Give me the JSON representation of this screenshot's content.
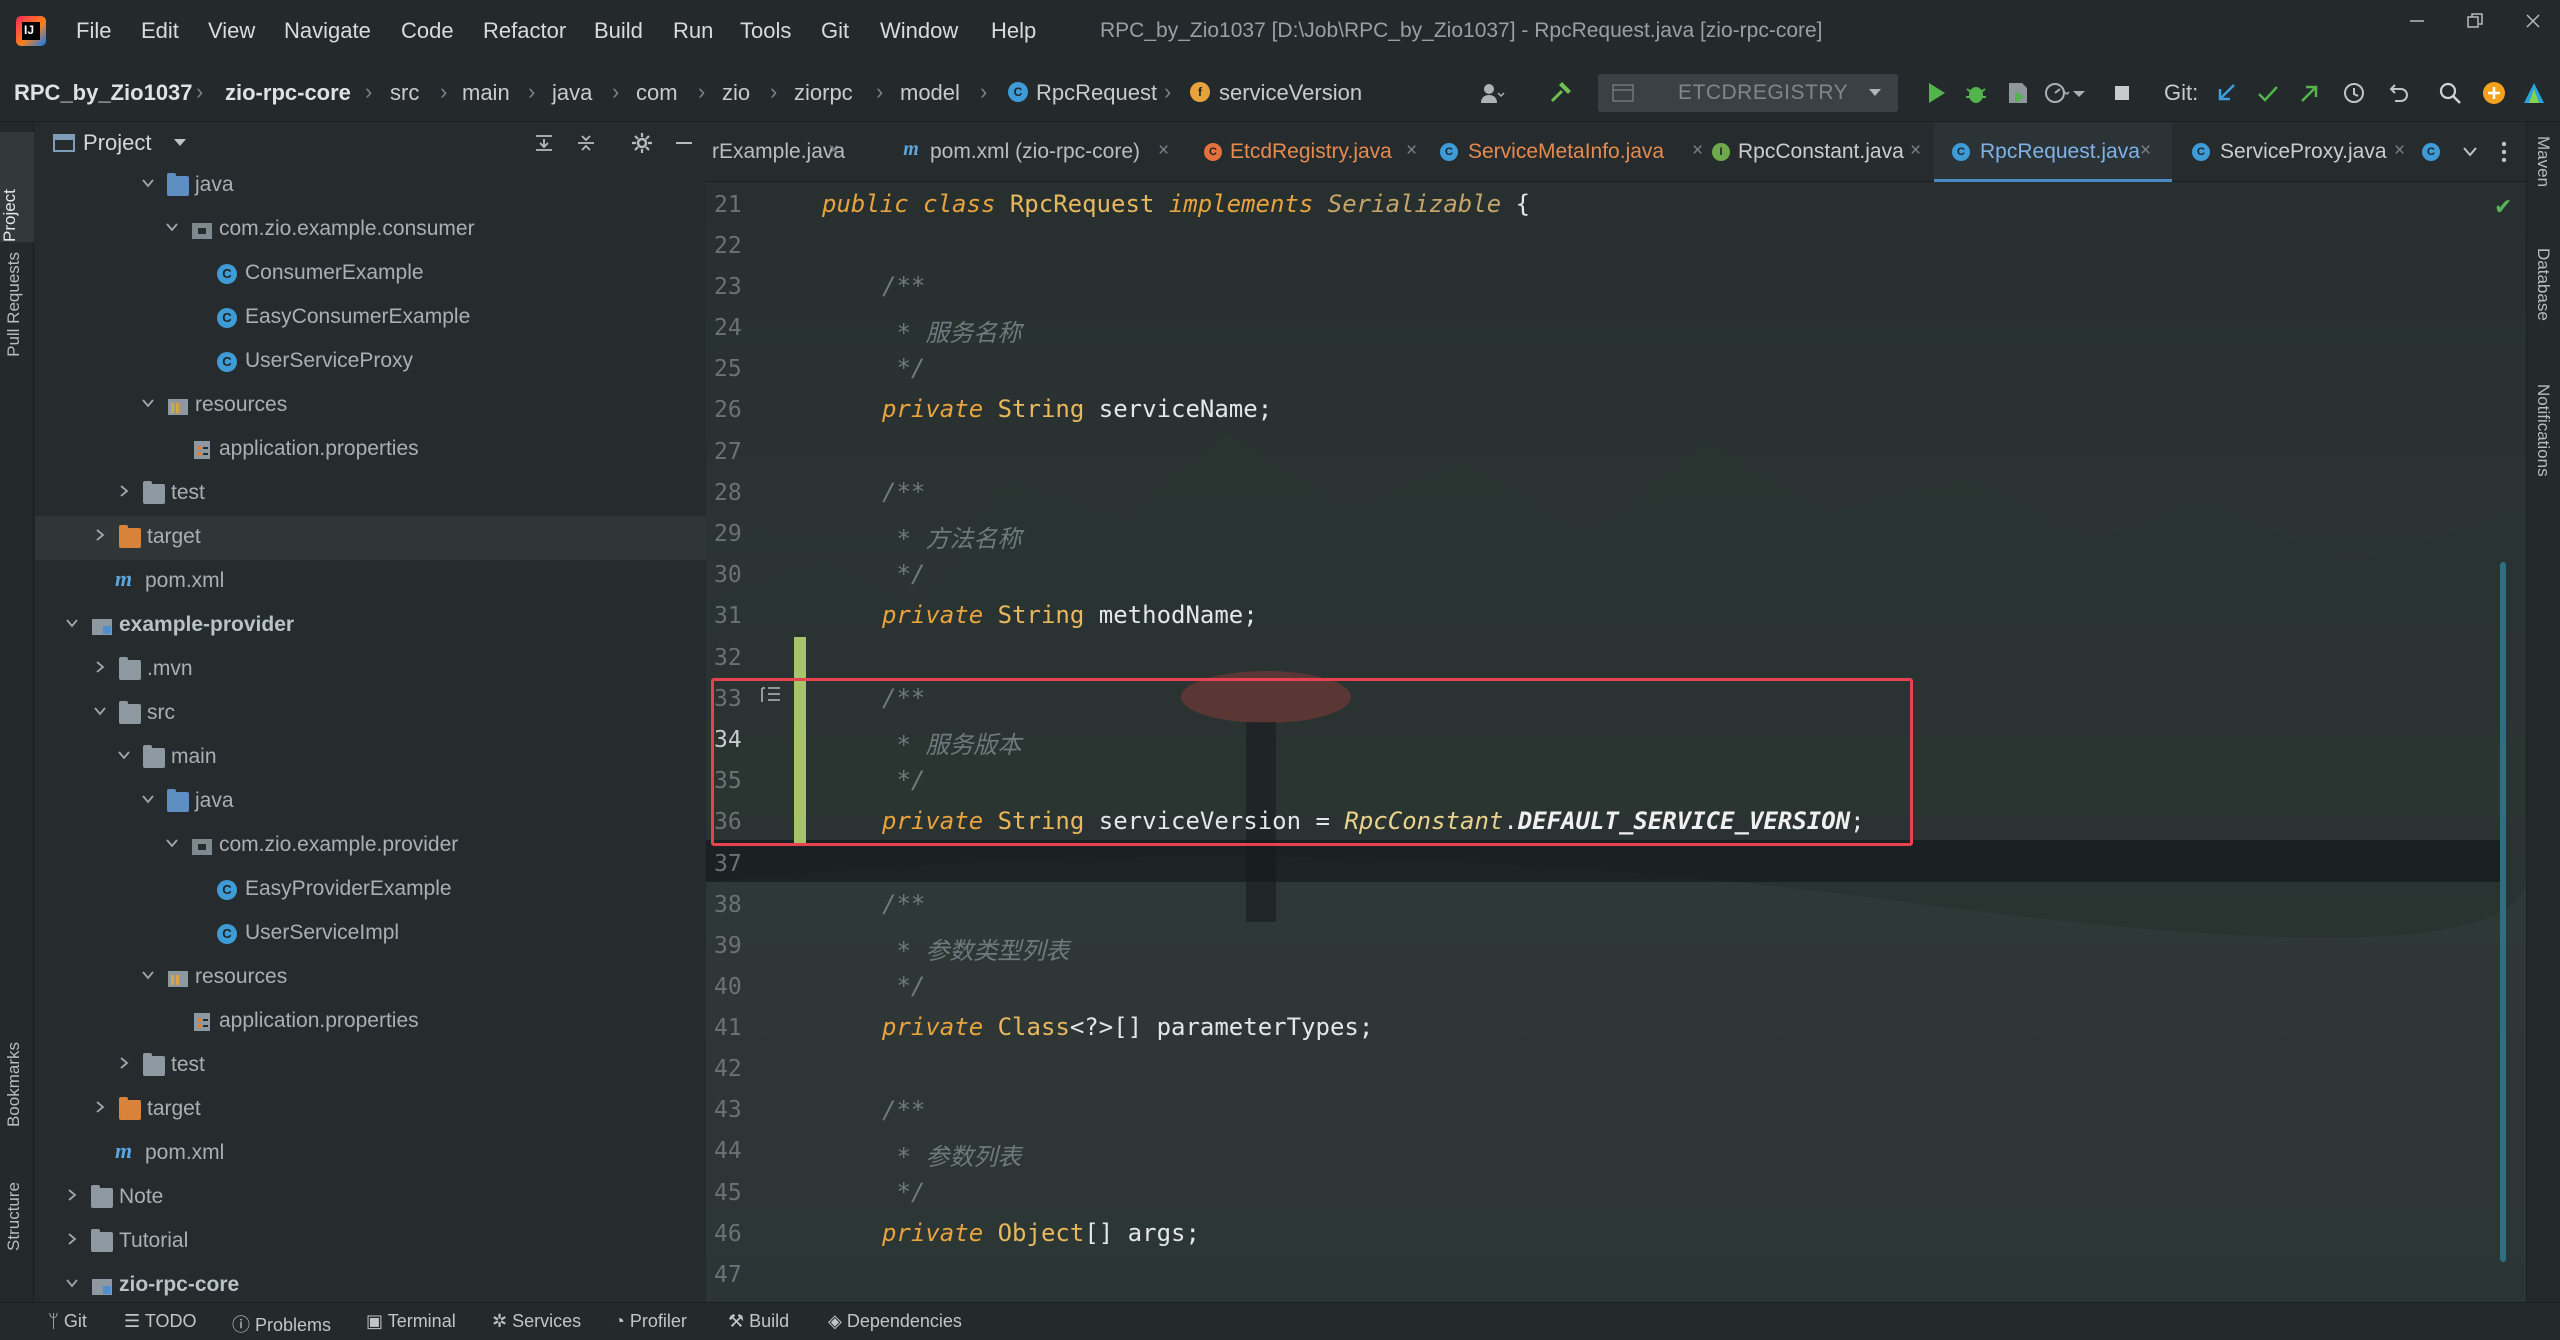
{
  "window": {
    "title": "RPC_by_Zio1037 [D:\\Job\\RPC_by_Zio1037] - RpcRequest.java [zio-rpc-core]"
  },
  "menu": [
    "File",
    "Edit",
    "View",
    "Navigate",
    "Code",
    "Refactor",
    "Build",
    "Run",
    "Tools",
    "Git",
    "Window",
    "Help"
  ],
  "breadcrumb": {
    "project": "RPC_by_Zio1037",
    "module": "zio-rpc-core",
    "path": [
      "src",
      "main",
      "java",
      "com",
      "zio",
      "ziorpc",
      "model"
    ],
    "class": "RpcRequest",
    "member": "serviceVersion"
  },
  "toolbar": {
    "run_config": "ETCDREGISTRY",
    "git_label": "Git:"
  },
  "left_stripe": [
    "Project",
    "Pull Requests",
    "Bookmarks",
    "Structure"
  ],
  "right_stripe": [
    "Maven",
    "Database",
    "Notifications"
  ],
  "project_panel": {
    "title": "Project",
    "tree": [
      {
        "label": "java",
        "type": "folder-blue"
      },
      {
        "label": "com.zio.example.consumer",
        "type": "package"
      },
      {
        "label": "ConsumerExample",
        "type": "class"
      },
      {
        "label": "EasyConsumerExample",
        "type": "class"
      },
      {
        "label": "UserServiceProxy",
        "type": "class"
      },
      {
        "label": "resources",
        "type": "folder-res"
      },
      {
        "label": "application.properties",
        "type": "properties"
      },
      {
        "label": "test",
        "type": "folder"
      },
      {
        "label": "target",
        "type": "folder-orange"
      },
      {
        "label": "pom.xml",
        "type": "maven"
      },
      {
        "label": "example-provider",
        "type": "module"
      },
      {
        "label": ".mvn",
        "type": "folder"
      },
      {
        "label": "src",
        "type": "folder"
      },
      {
        "label": "main",
        "type": "folder"
      },
      {
        "label": "java",
        "type": "folder-blue"
      },
      {
        "label": "com.zio.example.provider",
        "type": "package"
      },
      {
        "label": "EasyProviderExample",
        "type": "class"
      },
      {
        "label": "UserServiceImpl",
        "type": "class"
      },
      {
        "label": "resources",
        "type": "folder-res"
      },
      {
        "label": "application.properties",
        "type": "properties"
      },
      {
        "label": "test",
        "type": "folder"
      },
      {
        "label": "target",
        "type": "folder-orange"
      },
      {
        "label": "pom.xml",
        "type": "maven"
      },
      {
        "label": "Note",
        "type": "folder"
      },
      {
        "label": "Tutorial",
        "type": "folder"
      },
      {
        "label": "zio-rpc-core",
        "type": "module"
      }
    ]
  },
  "editor": {
    "tabs": [
      {
        "label": "rExample.java",
        "icon": ""
      },
      {
        "label": "pom.xml (zio-rpc-core)",
        "icon": "m"
      },
      {
        "label": "EtcdRegistry.java",
        "icon": "C"
      },
      {
        "label": "ServiceMetaInfo.java",
        "icon": "C"
      },
      {
        "label": "RpcConstant.java",
        "icon": "I"
      },
      {
        "label": "RpcRequest.java",
        "icon": "C",
        "active": true
      },
      {
        "label": "ServiceProxy.java",
        "icon": "C"
      }
    ],
    "line_numbers": [
      "21",
      "22",
      "23",
      "24",
      "25",
      "26",
      "27",
      "28",
      "29",
      "30",
      "31",
      "32",
      "33",
      "34",
      "35",
      "36",
      "37",
      "38",
      "39",
      "40",
      "41",
      "42",
      "43",
      "44",
      "45",
      "46",
      "47"
    ],
    "code": {
      "l21": {
        "kw1": "public",
        "kw2": "class",
        "name": "RpcRequest",
        "kw3": "implements",
        "iface": "Serializable",
        "brace": " {"
      },
      "c_open": "/**",
      "c_close": " */",
      "c_servicename": " * 服务名称",
      "f_servicename": "serviceName;",
      "c_methodname": " * 方法名称",
      "f_methodname": "methodName;",
      "c_serviceversion": " * 服务版本",
      "f_serviceversion": "serviceVersion = ",
      "v_class": "RpcConstant",
      "v_dot": ".",
      "v_const": "DEFAULT_SERVICE_VERSION",
      "v_semi": ";",
      "c_paramtypes": " * 参数类型列表",
      "t_class": "Class",
      "t_generic": "<?>[] ",
      "f_paramtypes": "parameterTypes;",
      "c_args": " * 参数列表",
      "t_object": "Object",
      "t_arr": "[] ",
      "f_args": "args;",
      "kw_private": "private",
      "t_string": "String"
    }
  },
  "statusbar": [
    "Git",
    "TODO",
    "Problems",
    "Terminal",
    "Services",
    "Profiler",
    "Build",
    "Dependencies"
  ]
}
